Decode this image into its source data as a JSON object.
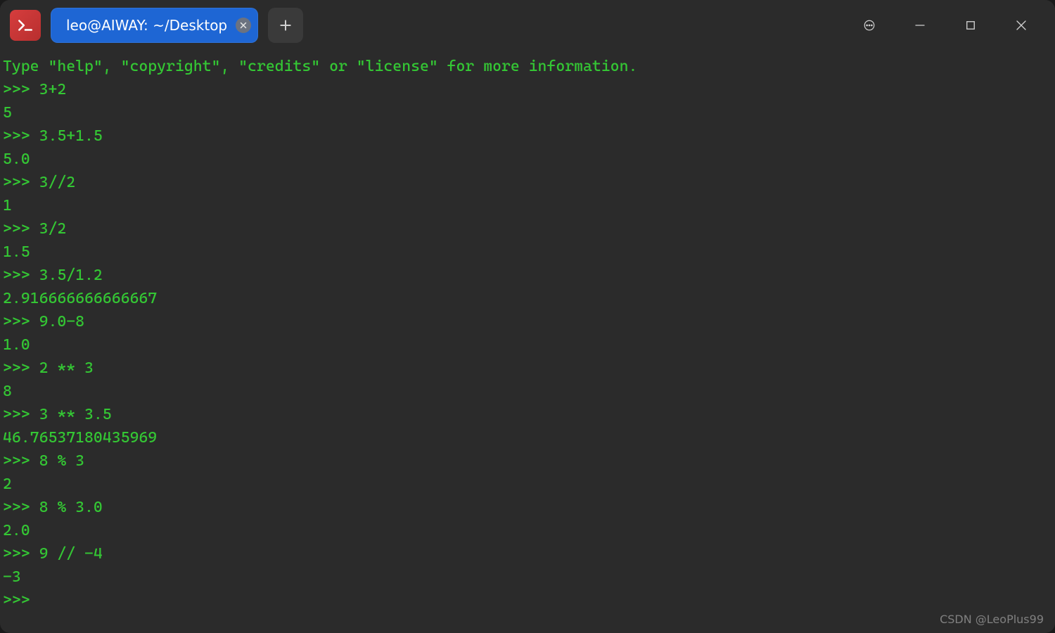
{
  "tab": {
    "title": "leo@AIWAY: ~/Desktop"
  },
  "terminal": {
    "header": "Type \"help\", \"copyright\", \"credits\" or \"license\" for more information.",
    "prompt": ">>> ",
    "entries": [
      {
        "input": "3+2",
        "output": "5"
      },
      {
        "input": "3.5+1.5",
        "output": "5.0"
      },
      {
        "input": "3//2",
        "output": "1"
      },
      {
        "input": "3/2",
        "output": "1.5"
      },
      {
        "input": "3.5/1.2",
        "output": "2.916666666666667"
      },
      {
        "input": "9.0-8",
        "output": "1.0"
      },
      {
        "input": "2 ** 3",
        "output": "8"
      },
      {
        "input": "3 ** 3.5",
        "output": "46.76537180435969"
      },
      {
        "input": "8 % 3",
        "output": "2"
      },
      {
        "input": "8 % 3.0",
        "output": "2.0"
      },
      {
        "input": "9 // -4",
        "output": "-3"
      }
    ],
    "trailing_prompt": ">>> "
  },
  "watermark": "CSDN @LeoPlus99"
}
